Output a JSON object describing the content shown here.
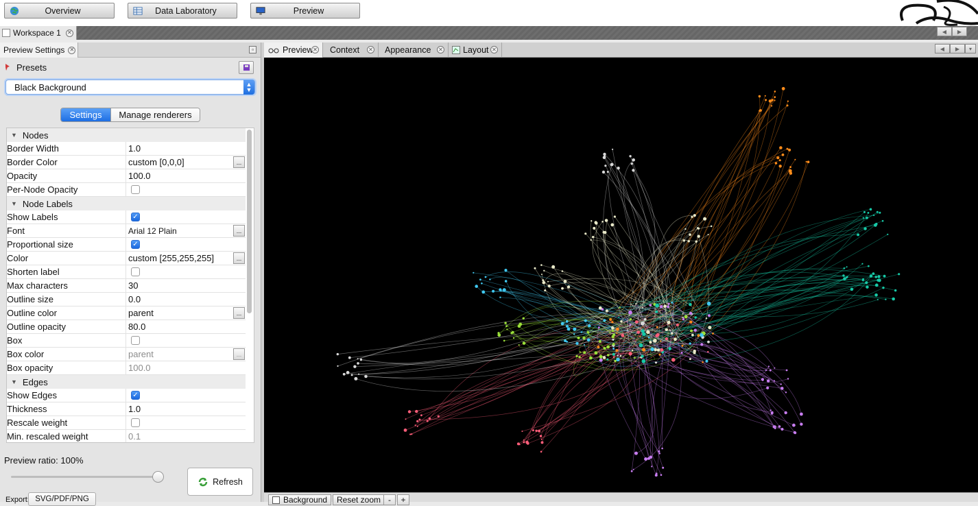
{
  "toolbar": {
    "overview_label": "Overview",
    "data_lab_label": "Data Laboratory",
    "preview_label": "Preview"
  },
  "workspace": {
    "tab_label": "Workspace 1"
  },
  "left_panel": {
    "tab_label": "Preview Settings",
    "presets_label": "Presets",
    "preset_value": "Black Background",
    "seg_settings": "Settings",
    "seg_renderers": "Manage renderers",
    "ratio_label": "Preview ratio:  100%",
    "ratio_value": 1.0,
    "refresh_label": "Refresh",
    "export_label": "Export:",
    "export_button": "SVG/PDF/PNG"
  },
  "properties": {
    "sections": [
      "Nodes",
      "Node Labels",
      "Edges"
    ],
    "rows": [
      {
        "name": "Border Width",
        "value": "1.0"
      },
      {
        "name": "Border Color",
        "value": "custom [0,0,0]"
      },
      {
        "name": "Opacity",
        "value": "100.0"
      },
      {
        "name": "Per-Node Opacity",
        "value": ""
      },
      {
        "name": "Show Labels",
        "value": ""
      },
      {
        "name": "Font",
        "value": "Arial 12 Plain"
      },
      {
        "name": "Proportional size",
        "value": ""
      },
      {
        "name": "Color",
        "value": "custom [255,255,255]"
      },
      {
        "name": "Shorten label",
        "value": ""
      },
      {
        "name": "Max characters",
        "value": "30"
      },
      {
        "name": "Outline size",
        "value": "0.0"
      },
      {
        "name": "Outline color",
        "value": "parent"
      },
      {
        "name": "Outline opacity",
        "value": "80.0"
      },
      {
        "name": "Box",
        "value": ""
      },
      {
        "name": "Box color",
        "value": "parent"
      },
      {
        "name": "Box opacity",
        "value": "100.0"
      },
      {
        "name": "Show Edges",
        "value": ""
      },
      {
        "name": "Thickness",
        "value": "1.0"
      },
      {
        "name": "Rescale weight",
        "value": ""
      },
      {
        "name": "Min. rescaled weight",
        "value": "0.1"
      }
    ]
  },
  "right_tabs": {
    "preview": "Preview",
    "context": "Context",
    "appearance": "Appearance",
    "layout": "Layout"
  },
  "bottom_bar": {
    "background_label": "Background",
    "reset_zoom_label": "Reset zoom",
    "zoom_out": "-",
    "zoom_in": "+"
  },
  "graph": {
    "clusters": [
      "#ff8c1a",
      "#17c9a7",
      "#40c8f0",
      "#9be03a",
      "#c77df0",
      "#ff5e7a",
      "#d9d9d9",
      "#e8e8c8"
    ]
  }
}
